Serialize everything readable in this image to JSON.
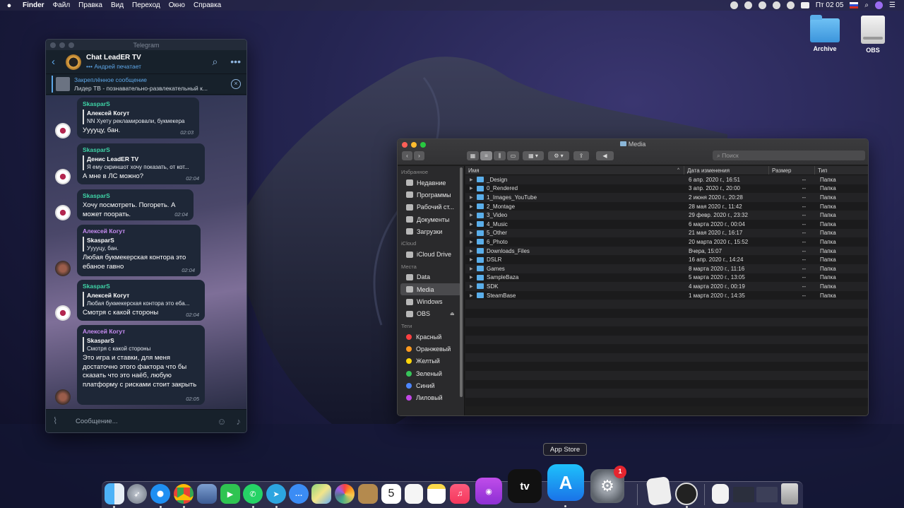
{
  "menubar": {
    "app": "Finder",
    "items": [
      "Файл",
      "Правка",
      "Вид",
      "Переход",
      "Окно",
      "Справка"
    ],
    "clock": "Пт 02 05"
  },
  "desktop": {
    "icons": [
      {
        "label": "Archive",
        "icon": "folder-icon"
      },
      {
        "label": "OBS",
        "icon": "drive-icon"
      }
    ]
  },
  "telegram": {
    "window_title": "Telegram",
    "chat_title": "Chat LeadER TV",
    "chat_status": "Андрей печатает",
    "pinned_title": "Закреплённое сообщение",
    "pinned_text": "Лидер ТВ - познавательно-развлекательный к...",
    "input_placeholder": "Сообщение...",
    "messages": [
      {
        "author": "SkasparS",
        "reply_author": "Алексей Когут",
        "reply_text": "NN Хуету рекламировали, букмекера",
        "text": "Ууууцу, бан.",
        "time": "02:03"
      },
      {
        "author": "SkasparS",
        "reply_author": "Денис LeadER TV",
        "reply_text": "Я ему скриншот хочу показать, от кот...",
        "text": "А мне в ЛС можно?",
        "time": "02:04"
      },
      {
        "author": "SkasparS",
        "reply_author": "",
        "reply_text": "",
        "text": "Хочу посмотреть. Погореть. А может поорать.",
        "time": "02:04"
      },
      {
        "author": "Алексей Когут",
        "reply_author": "SkasparS",
        "reply_text": "Ууууцу, бан.",
        "text": "Любая букмекерская контора это ебаное гавно",
        "time": "02:04"
      },
      {
        "author": "SkasparS",
        "reply_author": "Алексей Когут",
        "reply_text": "Любая букмекерская контора это еба...",
        "text": "Смотря с какой стороны",
        "time": "02:04"
      },
      {
        "author": "Алексей Когут",
        "reply_author": "SkasparS",
        "reply_text": "Смотря с какой стороны",
        "text": "Это игра и ставки, для меня достаточно этого фактора что бы сказать что это наёб, любую платформу с рисками стоит закрыть",
        "time": "02:05"
      }
    ]
  },
  "finder": {
    "window_title": "Media",
    "search_placeholder": "Поиск",
    "sidebar": {
      "favorites_header": "Избранное",
      "favorites": [
        "Недавние",
        "Программы",
        "Рабочий ст...",
        "Документы",
        "Загрузки"
      ],
      "icloud_header": "iCloud",
      "icloud": [
        "iCloud Drive"
      ],
      "places_header": "Места",
      "places": [
        "Data",
        "Media",
        "Windows",
        "OBS"
      ],
      "tags_header": "Теги",
      "tags": [
        {
          "label": "Красный",
          "color": "#ff4040"
        },
        {
          "label": "Оранжевый",
          "color": "#ff9a1e"
        },
        {
          "label": "Желтый",
          "color": "#ffd60a"
        },
        {
          "label": "Зеленый",
          "color": "#37c45a"
        },
        {
          "label": "Синий",
          "color": "#4d86ff"
        },
        {
          "label": "Лиловый",
          "color": "#c247e6"
        }
      ]
    },
    "columns": {
      "name": "Имя",
      "date": "Дата изменения",
      "size": "Размер",
      "type": "Тип"
    },
    "rows": [
      {
        "name": "_Design",
        "date": "6 апр. 2020 г., 16:51",
        "size": "--",
        "type": "Папка"
      },
      {
        "name": "0_Rendered",
        "date": "3 апр. 2020 г., 20:00",
        "size": "--",
        "type": "Папка"
      },
      {
        "name": "1_Images_YouTube",
        "date": "2 июня 2020 г., 20:28",
        "size": "--",
        "type": "Папка"
      },
      {
        "name": "2_Montage",
        "date": "28 мая 2020 г., 11:42",
        "size": "--",
        "type": "Папка"
      },
      {
        "name": "3_Video",
        "date": "29 февр. 2020 г., 23:32",
        "size": "--",
        "type": "Папка"
      },
      {
        "name": "4_Music",
        "date": "6 марта 2020 г., 00:04",
        "size": "--",
        "type": "Папка"
      },
      {
        "name": "5_Other",
        "date": "21 мая 2020 г., 16:17",
        "size": "--",
        "type": "Папка"
      },
      {
        "name": "6_Photo",
        "date": "20 марта 2020 г., 15:52",
        "size": "--",
        "type": "Папка"
      },
      {
        "name": "Downloads_Files",
        "date": "Вчера, 15:07",
        "size": "--",
        "type": "Папка"
      },
      {
        "name": "DSLR",
        "date": "16 апр. 2020 г., 14:24",
        "size": "--",
        "type": "Папка"
      },
      {
        "name": "Games",
        "date": "8 марта 2020 г., 11:16",
        "size": "--",
        "type": "Папка"
      },
      {
        "name": "SampleBaza",
        "date": "5 марта 2020 г., 13:05",
        "size": "--",
        "type": "Папка"
      },
      {
        "name": "SDK",
        "date": "4 марта 2020 г., 00:19",
        "size": "--",
        "type": "Папка"
      },
      {
        "name": "SteamBase",
        "date": "1 марта 2020 г., 14:35",
        "size": "--",
        "type": "Папка"
      }
    ]
  },
  "dock": {
    "tooltip": "App Store",
    "apple_tv_label": "tv",
    "calendar_day": "5",
    "settings_badge": "1"
  }
}
